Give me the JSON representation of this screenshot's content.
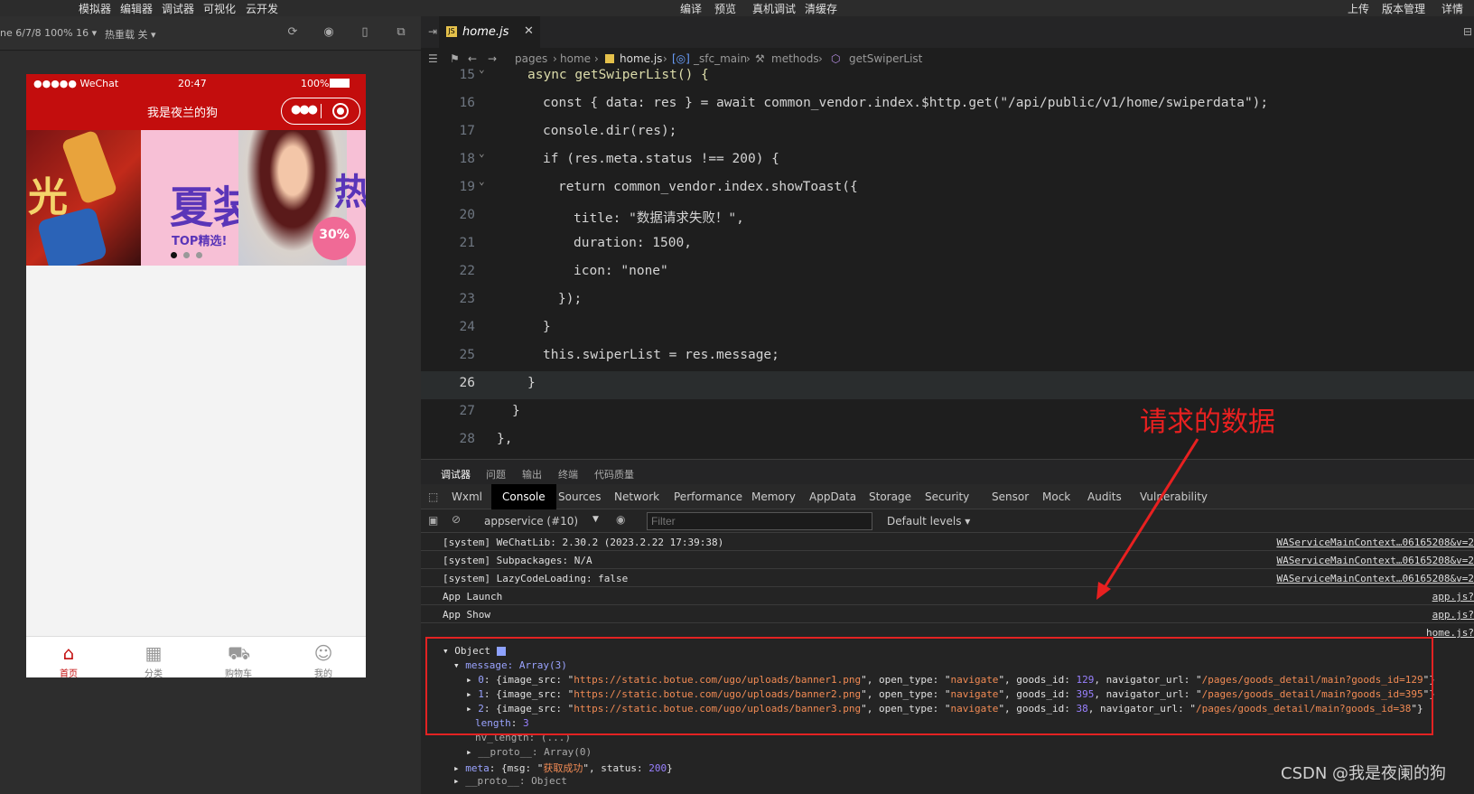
{
  "top_menu": {
    "left": [
      "模拟器",
      "编辑器",
      "调试器",
      "可视化",
      "云开发"
    ],
    "center": [
      "编译",
      "预览",
      "真机调试",
      "清缓存"
    ],
    "right": [
      "上传",
      "版本管理",
      "详情"
    ]
  },
  "simulator": {
    "device": "ne 6/7/8 100% 16 ▾",
    "hot_reload": "热重载 关 ▾",
    "status": {
      "carrier": "●●●●● WeChat",
      "time": "20:47",
      "battery": "100%"
    },
    "nav_title": "我是夜兰的狗",
    "banner_text": {
      "a": "光",
      "b_title": "夏装",
      "b_sub": "TOP精选!",
      "b_hot": "热",
      "b_off": "30%"
    },
    "tabbar": [
      {
        "label": "首页",
        "icon": "home-icon"
      },
      {
        "label": "分类",
        "icon": "grid-icon"
      },
      {
        "label": "购物车",
        "icon": "cart-icon"
      },
      {
        "label": "我的",
        "icon": "user-icon"
      }
    ]
  },
  "editor": {
    "tab": "home.js",
    "breadcrumb": [
      "pages",
      "home",
      "home.js",
      "_sfc_main",
      "methods",
      "getSwiperList"
    ],
    "lines": [
      {
        "n": "15",
        "code": "async getSwiperList() {"
      },
      {
        "n": "16",
        "code": "const { data: res } = await common_vendor.index.$http.get(\"/api/public/v1/home/swiperdata\");"
      },
      {
        "n": "17",
        "code": "console.dir(res);"
      },
      {
        "n": "18",
        "code": "if (res.meta.status !== 200) {"
      },
      {
        "n": "19",
        "code": "return common_vendor.index.showToast({"
      },
      {
        "n": "20",
        "code": "title: \"数据请求失败！\","
      },
      {
        "n": "21",
        "code": "duration: 1500,"
      },
      {
        "n": "22",
        "code": "icon: \"none\""
      },
      {
        "n": "23",
        "code": "});"
      },
      {
        "n": "24",
        "code": "}"
      },
      {
        "n": "25",
        "code": "this.swiperList = res.message;"
      },
      {
        "n": "26",
        "code": "}"
      },
      {
        "n": "27",
        "code": "}"
      },
      {
        "n": "28",
        "code": "},"
      }
    ]
  },
  "devtools": {
    "top_tabs": [
      "调试器",
      "问题",
      "输出",
      "终端",
      "代码质量"
    ],
    "tabs": [
      "Wxml",
      "Console",
      "Sources",
      "Network",
      "Performance",
      "Memory",
      "AppData",
      "Storage",
      "Security",
      "Sensor",
      "Mock",
      "Audits",
      "Vulnerability"
    ],
    "context": "appservice (#10)",
    "filter_placeholder": "Filter",
    "levels": "Default levels ▾",
    "logs": [
      {
        "msg": "[system] WeChatLib: 2.30.2 (2023.2.22 17:39:38)",
        "src": "WAServiceMainContext…06165208&v=2"
      },
      {
        "msg": "[system] Subpackages: N/A",
        "src": "WAServiceMainContext…06165208&v=2"
      },
      {
        "msg": "[system] LazyCodeLoading: false",
        "src": "WAServiceMainContext…06165208&v=2"
      },
      {
        "msg": "App Launch",
        "src": "app.js?"
      },
      {
        "msg": "App Show",
        "src": "app.js?"
      },
      {
        "msg": "",
        "src": "home.js?"
      }
    ],
    "object": {
      "root": "Object",
      "message": "message: Array(3)",
      "items": [
        {
          "idx": "0",
          "banner": "https://static.botue.com/ugo/uploads/banner1.png",
          "goods_id": "129",
          "url": "/pages/goods_detail/main?goods_id=129"
        },
        {
          "idx": "1",
          "banner": "https://static.botue.com/ugo/uploads/banner2.png",
          "goods_id": "395",
          "url": "/pages/goods_detail/main?goods_id=395"
        },
        {
          "idx": "2",
          "banner": "https://static.botue.com/ugo/uploads/banner3.png",
          "goods_id": "38",
          "url": "/pages/goods_detail/main?goods_id=38"
        }
      ],
      "open_type": "navigate",
      "length": "3",
      "nv_length": "nv_length: (...)",
      "proto_array": "__proto__: Array(0)",
      "meta_msg": "获取成功",
      "meta_status": "200",
      "proto_object": "__proto__: Object"
    }
  },
  "annotation": "请求的数据",
  "watermark": "CSDN @我是夜阑的狗"
}
